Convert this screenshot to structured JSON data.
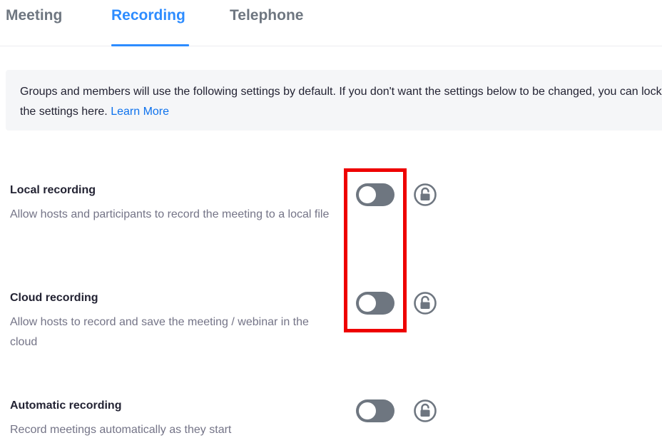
{
  "tabs": [
    {
      "label": "Meeting",
      "active": false
    },
    {
      "label": "Recording",
      "active": true
    },
    {
      "label": "Telephone",
      "active": false
    }
  ],
  "banner": {
    "text": "Groups and members will use the following settings by default. If you don't want the settings below to be changed, you can lock the settings here.",
    "link": "Learn More"
  },
  "settings": [
    {
      "title": "Local recording",
      "description": "Allow hosts and participants to record the meeting to a local file",
      "enabled": false,
      "locked": false
    },
    {
      "title": "Cloud recording",
      "description": "Allow hosts to record and save the meeting / webinar in the cloud",
      "enabled": false,
      "locked": false
    },
    {
      "title": "Automatic recording",
      "description": "Record meetings automatically as they start",
      "enabled": false,
      "locked": false
    }
  ],
  "colors": {
    "accent": "#2d8cff",
    "link": "#0e72ed",
    "toggle_off": "#6e7680",
    "highlight": "#ee0000"
  },
  "icons": {
    "lock": "unlock-icon"
  }
}
